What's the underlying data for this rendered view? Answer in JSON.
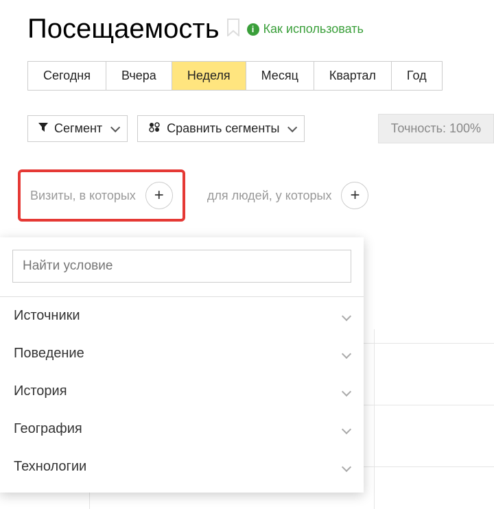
{
  "title": "Посещаемость",
  "help_link": "Как использовать",
  "range_tabs": [
    {
      "label": "Сегодня",
      "active": false
    },
    {
      "label": "Вчера",
      "active": false
    },
    {
      "label": "Неделя",
      "active": true
    },
    {
      "label": "Месяц",
      "active": false
    },
    {
      "label": "Квартал",
      "active": false
    },
    {
      "label": "Год",
      "active": false
    }
  ],
  "segment_btn": "Сегмент",
  "compare_btn": "Сравнить сегменты",
  "accuracy_label": "Точность: 100%",
  "condition_visits": "Визиты, в которых",
  "condition_people": "для людей, у которых",
  "search_placeholder": "Найти условие",
  "categories": [
    "Источники",
    "Поведение",
    "История",
    "География",
    "Технологии"
  ]
}
